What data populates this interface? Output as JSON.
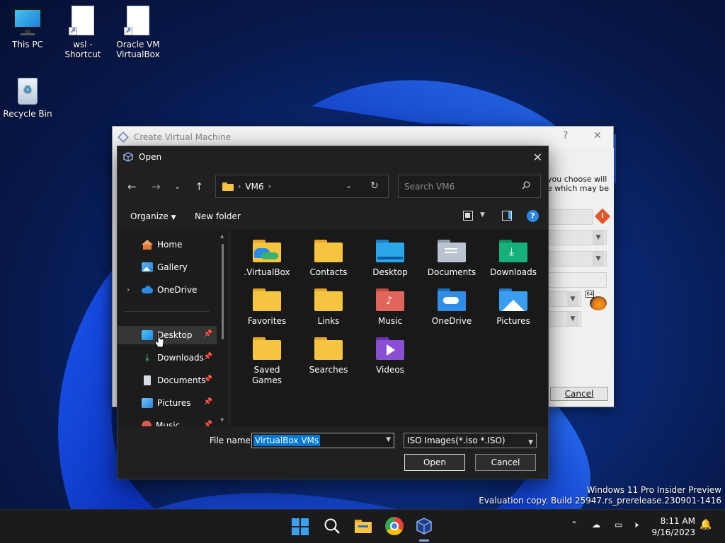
{
  "desktop": {
    "icons": [
      {
        "label": "This PC"
      },
      {
        "label": "wsl - Shortcut"
      },
      {
        "label": "Oracle VM VirtualBox"
      },
      {
        "label": "Recycle Bin"
      }
    ],
    "watermark_line1": "Windows 11 Pro Insider Preview",
    "watermark_line2": "Evaluation copy. Build 25947.rs_prerelease.230901-1416"
  },
  "vm_dialog": {
    "title": "Create Virtual Machine",
    "help": "?",
    "close": "✕",
    "hint_line1": "you choose will",
    "hint_line2": "e which may be",
    "cancel_label": "Cancel",
    "os_badge": "64"
  },
  "open_dialog": {
    "title": "Open",
    "close": "✕",
    "breadcrumb": [
      "VM6"
    ],
    "search_placeholder": "Search VM6",
    "organize_label": "Organize",
    "new_folder_label": "New folder",
    "help": "?",
    "nav_items": [
      {
        "label": "Home"
      },
      {
        "label": "Gallery"
      },
      {
        "label": "OneDrive"
      },
      {
        "label": "Desktop"
      },
      {
        "label": "Downloads"
      },
      {
        "label": "Documents"
      },
      {
        "label": "Pictures"
      },
      {
        "label": "Music"
      }
    ],
    "folders": [
      {
        "label": ".VirtualBox"
      },
      {
        "label": "Contacts"
      },
      {
        "label": "Desktop"
      },
      {
        "label": "Documents"
      },
      {
        "label": "Downloads"
      },
      {
        "label": "Favorites"
      },
      {
        "label": "Links"
      },
      {
        "label": "Music"
      },
      {
        "label": "OneDrive"
      },
      {
        "label": "Pictures"
      },
      {
        "label": "Saved Games"
      },
      {
        "label": "Searches"
      },
      {
        "label": "Videos"
      }
    ],
    "file_name_label": "File name:",
    "file_name_value": "VirtualBox VMs",
    "file_type": "ISO Images(*.iso *.ISO)",
    "open_label": "Open",
    "cancel_label": "Cancel"
  },
  "taskbar": {
    "time": "8:11 AM",
    "date": "9/16/2023"
  },
  "colors": {
    "accent": "#0078d4",
    "folder_yellow": "#f5c542",
    "dialog_bg": "#202020"
  }
}
